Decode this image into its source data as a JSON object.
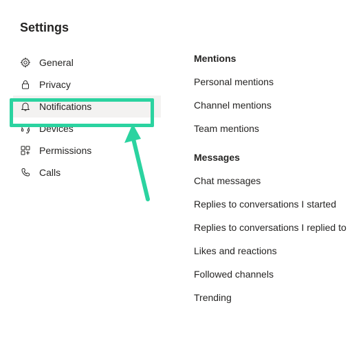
{
  "title": "Settings",
  "sidebar": {
    "items": [
      {
        "label": "General",
        "icon": "gear-icon",
        "selected": false
      },
      {
        "label": "Privacy",
        "icon": "lock-icon",
        "selected": false
      },
      {
        "label": "Notifications",
        "icon": "bell-icon",
        "selected": true
      },
      {
        "label": "Devices",
        "icon": "headset-icon",
        "selected": false
      },
      {
        "label": "Permissions",
        "icon": "app-icon",
        "selected": false
      },
      {
        "label": "Calls",
        "icon": "phone-icon",
        "selected": false
      }
    ]
  },
  "main": {
    "sections": [
      {
        "heading": "Mentions",
        "options": [
          "Personal mentions",
          "Channel mentions",
          "Team mentions"
        ]
      },
      {
        "heading": "Messages",
        "options": [
          "Chat messages",
          "Replies to conversations I started",
          "Replies to conversations I replied to",
          "Likes and reactions",
          "Followed channels",
          "Trending"
        ]
      }
    ]
  },
  "annotation": {
    "highlight_color": "#2bd3a0"
  }
}
